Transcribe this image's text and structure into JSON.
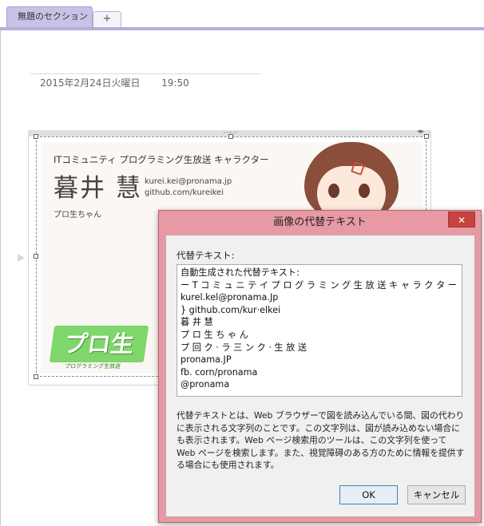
{
  "tabs": {
    "active_section": "無題のセクション",
    "add_label": "+"
  },
  "page": {
    "date": "2015年2月24日火曜日",
    "time": "19:50"
  },
  "card": {
    "header": "ITコミュニティ プログラミング生放送 キャラクター",
    "name": "暮井 慧",
    "email": "kurei.kei@pronama.jp",
    "github": "github.com/kureikei",
    "nickname": "プロ生ちゃん",
    "logo_text": "プロ生",
    "logo_subtext": "プログラミング生放送"
  },
  "dialog": {
    "title": "画像の代替テキスト",
    "close_label": "✕",
    "alt_label": "代替テキスト:",
    "alt_text": "自動生成された代替テキスト:\nー T コ ミ ュ ニ テ イ プ ロ グ ラ ミ ン グ 生 放 送 キ ャ ラ ク タ ー\nkurel.kel@pronama.Jp\n} github.com/kur·elkei\n暮 井 慧\nプ ロ 生 ち ゃ ん\nプ 回 ク · ラ 三 ン ク · 生 放 送\npronama.JP\nfb. corn/pronama\n@pronama",
    "description": "代替テキストとは、Web ブラウザーで図を読み込んでいる間、図の代わりに表示される文字列のことです。この文字列は、図が読み込めない場合にも表示されます。Web ページ検索用のツールは、この文字列を使って Web ページを検索します。また、視覚障碍のある方のために情報を提供する場合にも使用されます。",
    "ok_label": "OK",
    "cancel_label": "キャンセル"
  },
  "colors": {
    "tab_active": "#c8c3e6",
    "dialog_frame": "#e79aa4",
    "close_button": "#c7433f",
    "logo_green": "#7fd66a"
  }
}
